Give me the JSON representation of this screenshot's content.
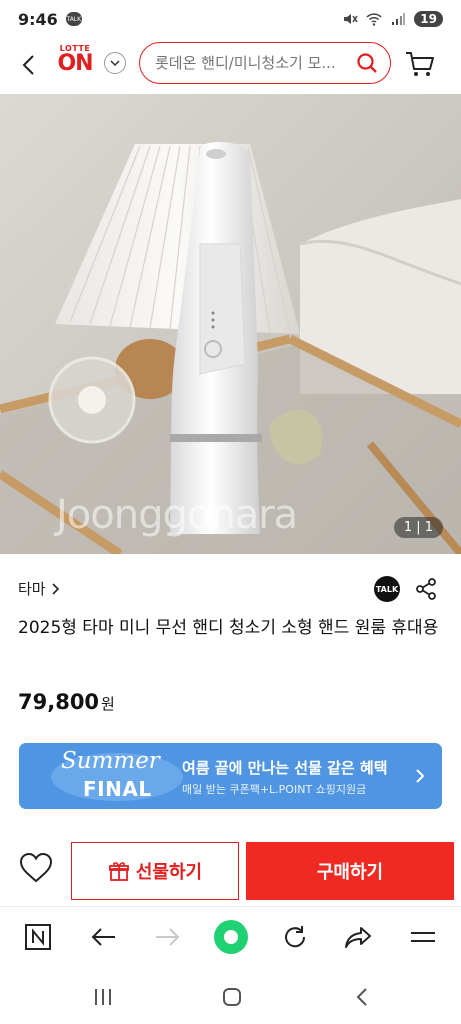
{
  "status_bar": {
    "time": "9:46",
    "talk_badge": "TALK",
    "battery": "19"
  },
  "header": {
    "logo_top": "LOTTE",
    "logo_main": "ON",
    "search_placeholder": "롯데온 핸디/미니청소기 모..."
  },
  "gallery": {
    "watermark": "Joonggonara",
    "counter": "1 | 1"
  },
  "product": {
    "brand": "타마",
    "talk_label": "TALK",
    "title": "2025형 타마 미니 무선 핸디 청소기 소형 핸드 원룸 휴대용",
    "price": "79,800",
    "price_unit": "원"
  },
  "banner": {
    "summer": "Summer",
    "final": "FINAL",
    "title": "여름 끝에 만나는 선물 같은 혜택",
    "subtitle": "매일 받는 쿠폰팩+L.POINT 쇼핑지원금"
  },
  "actions": {
    "gift_label": "선물하기",
    "buy_label": "구매하기"
  },
  "icons": {
    "brand_red": "#e02020",
    "buy_red": "#ef2a23",
    "banner_blue": "#4f95e2",
    "browser_green": "#1fd173"
  }
}
